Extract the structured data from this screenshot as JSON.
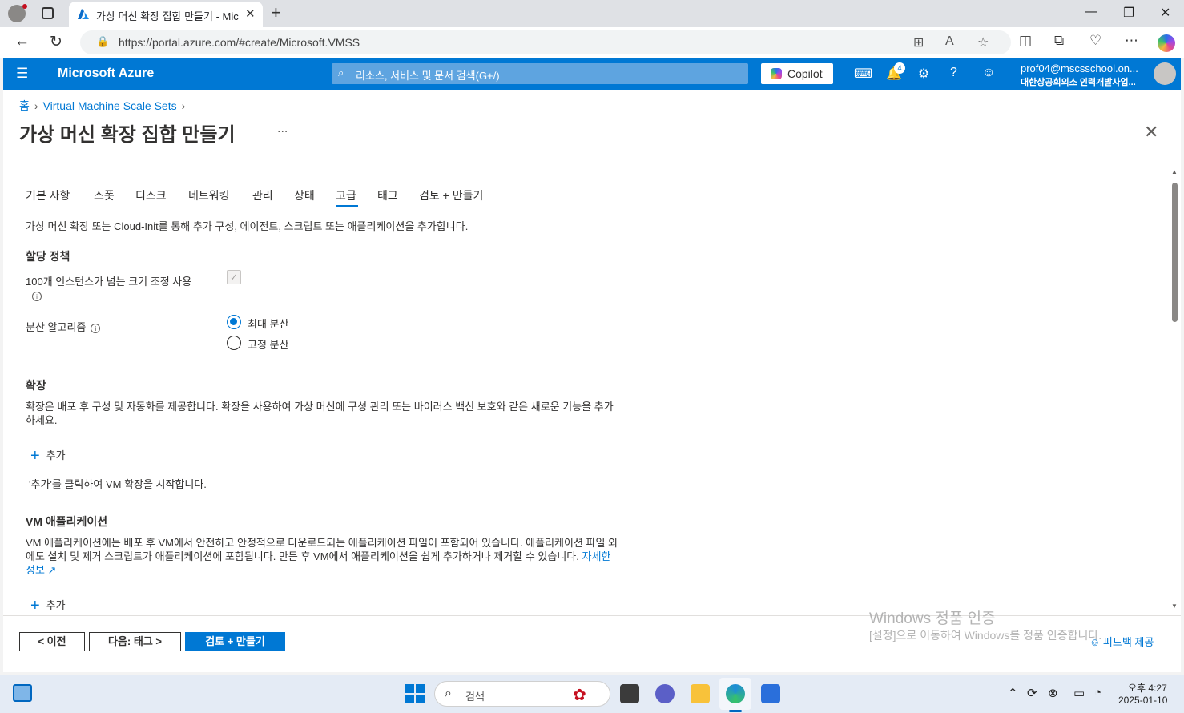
{
  "browser": {
    "tab_title": "가상 머신 확장 집합 만들기 - Mic",
    "url": "https://portal.azure.com/#create/Microsoft.VMSS"
  },
  "azure": {
    "brand": "Microsoft Azure",
    "search_placeholder": "리소스, 서비스 및 문서 검색(G+/)",
    "copilot_label": "Copilot",
    "notification_count": "4",
    "account_name": "prof04@mscsschool.on...",
    "account_org": "대한상공회의소 인력개발사업..."
  },
  "breadcrumb": [
    "홈",
    "Virtual Machine Scale Sets"
  ],
  "page": {
    "title": "가상 머신 확장 집합 만들기",
    "more": "...",
    "tabs": [
      "기본 사항",
      "스폿",
      "디스크",
      "네트워킹",
      "관리",
      "상태",
      "고급",
      "태그",
      "검토 + 만들기"
    ],
    "active_tab": "고급",
    "description": "가상 머신 확장 또는 Cloud-Init를 통해 추가 구성, 에이전트, 스크립트 또는 애플리케이션을 추가합니다."
  },
  "allocation": {
    "heading": "할당 정책",
    "scale_label": "100개 인스턴스가 넘는 크기 조정 사용",
    "scale_checked": true,
    "spread_label": "분산 알고리즘",
    "options": [
      "최대 분산",
      "고정 분산"
    ],
    "selected_option": "최대 분산"
  },
  "extensions": {
    "heading": "확장",
    "text": "확장은 배포 후 구성 및 자동화를 제공합니다. 확장을 사용하여 가상 머신에 구성 관리 또는 바이러스 백신 보호와 같은 새로운 기능을 추가하세요.",
    "add_label": "추가",
    "hint": "'추가'를 클릭하여 VM 확장을 시작합니다."
  },
  "vm_apps": {
    "heading": "VM 애플리케이션",
    "text": "VM 애플리케이션에는 배포 후 VM에서 안전하고 안정적으로 다운로드되는 애플리케이션 파일이 포함되어 있습니다. 애플리케이션 파일 외에도 설치 및 제거 스크립트가 애플리케이션에 포함됩니다. 만든 후 VM에서 애플리케이션을 쉽게 추가하거나 제거할 수 있습니다.",
    "link": "자세한 정보",
    "add_label": "추가"
  },
  "footer": {
    "prev": "< 이전",
    "next": "다음: 태그 >",
    "review": "검토 + 만들기",
    "feedback": "피드백 제공"
  },
  "watermark": {
    "line1": "Windows 정품 인증",
    "line2": "[설정]으로 이동하여 Windows를 정품 인증합니다."
  },
  "taskbar": {
    "search": "검색",
    "time": "오후 4:27",
    "date": "2025-01-10"
  },
  "colors": {
    "azure_blue": "#0078d4",
    "header_search": "#5ea4e0"
  }
}
